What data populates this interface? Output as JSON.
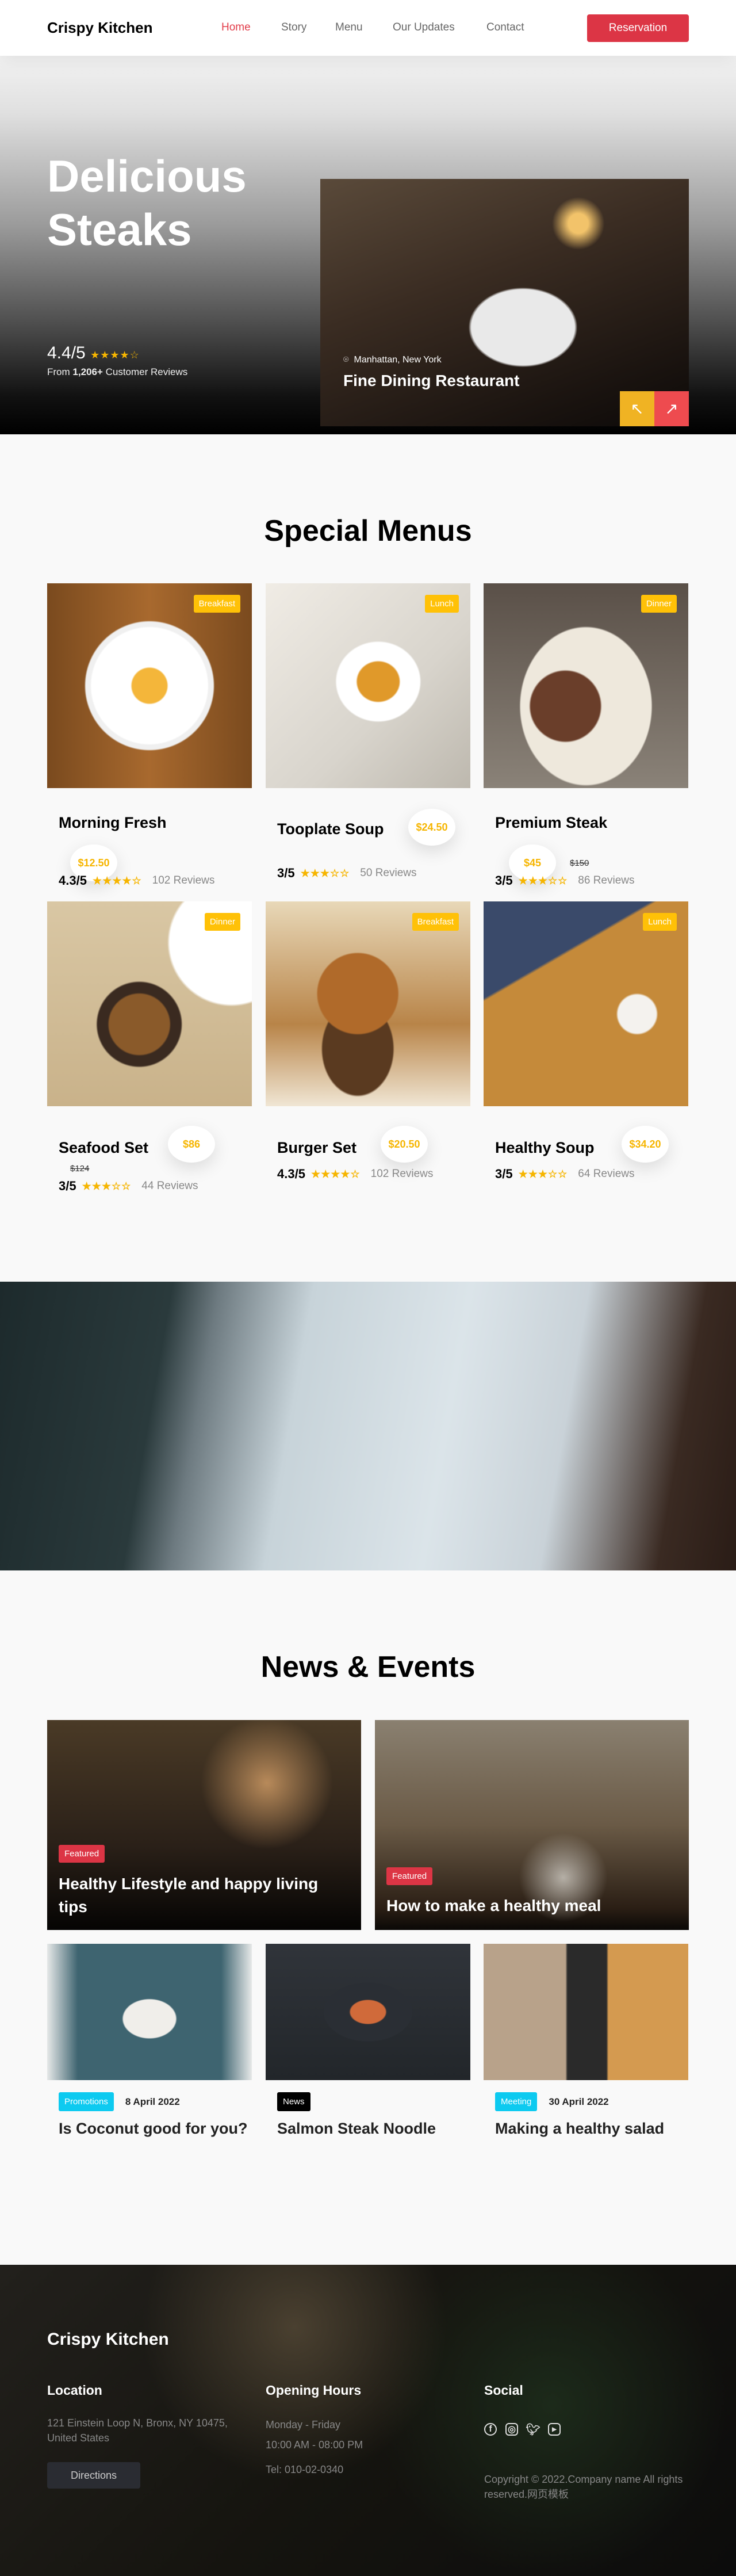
{
  "nav": {
    "brand": "Crispy Kitchen",
    "links": [
      "Home",
      "Story",
      "Menu",
      "Our Updates",
      "Contact"
    ],
    "active": "Home",
    "reservation": "Reservation"
  },
  "hero": {
    "title_line1": "Delicious",
    "title_line2": "Steaks",
    "rating": "4.4/5",
    "stars": "★★★★☆",
    "from": "From ",
    "review_count": "1,206+",
    "reviews_suffix": " Customer Reviews",
    "location": "Manhattan, New York",
    "image_title": "Fine Dining Restaurant",
    "prev_icon": "↖",
    "next_icon": "↗",
    "colors": {
      "prev": "#f0b323",
      "next": "#ee4b4f"
    }
  },
  "menus": {
    "title": "Special Menus",
    "items": [
      {
        "category": "Breakfast",
        "name": "Morning Fresh",
        "price": "$12.50",
        "old_price": "",
        "rating": "4.3/5",
        "stars": "★★★★☆",
        "reviews": "102 Reviews"
      },
      {
        "category": "Lunch",
        "name": "Tooplate Soup",
        "price": "$24.50",
        "old_price": "",
        "rating": "3/5",
        "stars": "★★★☆☆",
        "reviews": "50 Reviews"
      },
      {
        "category": "Dinner",
        "name": "Premium Steak",
        "price": "$45",
        "old_price": "$150",
        "rating": "3/5",
        "stars": "★★★☆☆",
        "reviews": "86 Reviews"
      },
      {
        "category": "Dinner",
        "name": "Seafood Set",
        "price": "$86",
        "old_price": "$124",
        "rating": "3/5",
        "stars": "★★★☆☆",
        "reviews": "44 Reviews"
      },
      {
        "category": "Breakfast",
        "name": "Burger Set",
        "price": "$20.50",
        "old_price": "",
        "rating": "4.3/5",
        "stars": "★★★★☆",
        "reviews": "102 Reviews"
      },
      {
        "category": "Lunch",
        "name": "Healthy Soup",
        "price": "$34.20",
        "old_price": "",
        "rating": "3/5",
        "stars": "★★★☆☆",
        "reviews": "64 Reviews"
      }
    ]
  },
  "news": {
    "title": "News & Events",
    "featured": [
      {
        "tag": "Featured",
        "title": "Healthy Lifestyle and happy living tips"
      },
      {
        "tag": "Featured",
        "title": "How to make a healthy meal"
      }
    ],
    "items": [
      {
        "tag": "Promotions",
        "tag_color": "#0dcaf0",
        "date": "8 April 2022",
        "title": "Is Coconut good for you?"
      },
      {
        "tag": "News",
        "tag_color": "#000000",
        "date": "",
        "title": "Salmon Steak Noodle"
      },
      {
        "tag": "Meeting",
        "tag_color": "#0dcaf0",
        "date": "30 April 2022",
        "title": "Making a healthy salad"
      }
    ]
  },
  "footer": {
    "brand": "Crispy Kitchen",
    "location_title": "Location",
    "address_line1": "121 Einstein Loop N, Bronx, NY 10475,",
    "address_line2": "United States",
    "directions": "Directions",
    "hours_title": "Opening Hours",
    "days": "Monday - Friday",
    "hours": "10:00 AM - 08:00 PM",
    "tel": "Tel: 010-02-0340",
    "social_title": "Social",
    "social_icons": [
      "facebook-icon",
      "instagram-icon",
      "twitter-icon",
      "youtube-icon"
    ],
    "copyright": "Copyright © 2022.Company name All rights reserved.网页模板"
  }
}
